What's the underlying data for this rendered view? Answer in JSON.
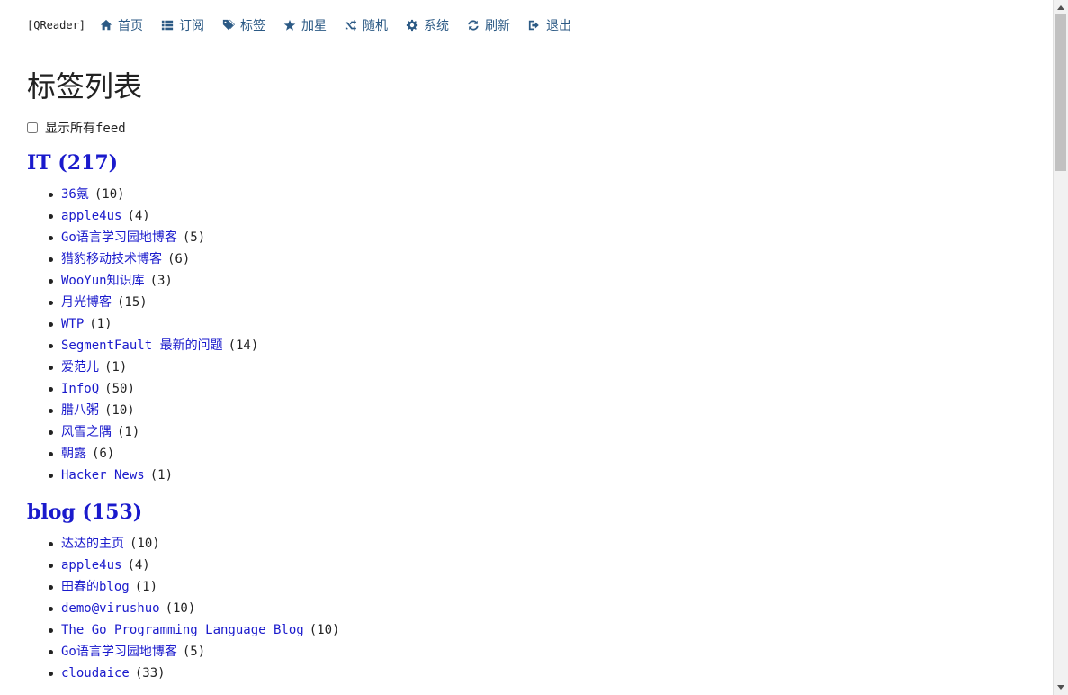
{
  "nav": {
    "brand": "[QReader]",
    "items": [
      {
        "label": "首页",
        "icon": "home-icon"
      },
      {
        "label": "订阅",
        "icon": "list-icon"
      },
      {
        "label": "标签",
        "icon": "tags-icon"
      },
      {
        "label": "加星",
        "icon": "star-icon"
      },
      {
        "label": "随机",
        "icon": "random-icon"
      },
      {
        "label": "系统",
        "icon": "gear-icon"
      },
      {
        "label": "刷新",
        "icon": "refresh-icon"
      },
      {
        "label": "退出",
        "icon": "sign-out-icon"
      }
    ]
  },
  "page": {
    "title": "标签列表",
    "show_all_label": "显示所有feed",
    "show_all_checked": false
  },
  "tags": [
    {
      "heading": "IT (217)",
      "feeds": [
        {
          "name": "36氪",
          "count": "(10)"
        },
        {
          "name": "apple4us",
          "count": "(4)"
        },
        {
          "name": "Go语言学习园地博客",
          "count": "(5)"
        },
        {
          "name": "猎豹移动技术博客",
          "count": "(6)"
        },
        {
          "name": "WooYun知识库",
          "count": "(3)"
        },
        {
          "name": "月光博客",
          "count": "(15)"
        },
        {
          "name": "WTP",
          "count": "(1)"
        },
        {
          "name": "SegmentFault 最新的问题",
          "count": "(14)"
        },
        {
          "name": "爱范儿",
          "count": "(1)"
        },
        {
          "name": "InfoQ",
          "count": "(50)"
        },
        {
          "name": "腊八粥",
          "count": "(10)"
        },
        {
          "name": "风雪之隅",
          "count": "(1)"
        },
        {
          "name": "朝露",
          "count": "(6)"
        },
        {
          "name": "Hacker News",
          "count": "(1)"
        }
      ]
    },
    {
      "heading": "blog (153)",
      "feeds": [
        {
          "name": "达达的主页",
          "count": "(10)"
        },
        {
          "name": "apple4us",
          "count": "(4)"
        },
        {
          "name": "田春的blog",
          "count": "(1)"
        },
        {
          "name": "demo@virushuo",
          "count": "(10)"
        },
        {
          "name": "The Go Programming Language Blog",
          "count": "(10)"
        },
        {
          "name": "Go语言学习园地博客",
          "count": "(5)"
        },
        {
          "name": "cloudaice",
          "count": "(33)"
        }
      ]
    }
  ],
  "colors": {
    "link": "#1a1acc",
    "nav_link": "#2c5a85",
    "text": "#222222"
  }
}
